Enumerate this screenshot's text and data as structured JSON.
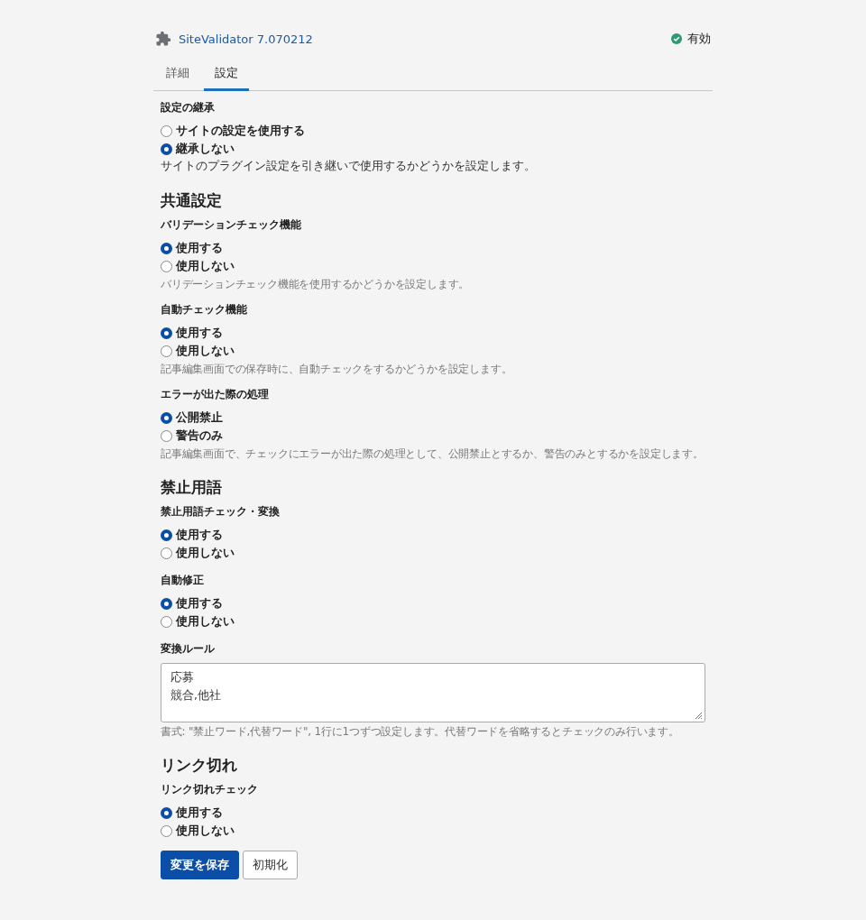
{
  "header": {
    "plugin_name": "SiteValidator 7.070212",
    "status": "有効",
    "enabled": true
  },
  "tabs": [
    {
      "label": "詳細",
      "selected": false
    },
    {
      "label": "設定",
      "selected": true
    }
  ],
  "inheritance": {
    "label": "設定の継承",
    "options": [
      {
        "label": "サイトの設定を使用する",
        "selected": false
      },
      {
        "label": "継承しない",
        "selected": true
      }
    ],
    "description": "サイトのプラグイン設定を引き継いで使用するかどうかを設定します。"
  },
  "sections": [
    {
      "heading": "共通設定",
      "fields": [
        {
          "kind": "radio",
          "label": "バリデーションチェック機能",
          "options": [
            {
              "label": "使用する",
              "selected": true
            },
            {
              "label": "使用しない",
              "selected": false
            }
          ],
          "help": "バリデーションチェック機能を使用するかどうかを設定します。"
        },
        {
          "kind": "radio",
          "label": "自動チェック機能",
          "options": [
            {
              "label": "使用する",
              "selected": true
            },
            {
              "label": "使用しない",
              "selected": false
            }
          ],
          "help": "記事編集画面での保存時に、自動チェックをするかどうかを設定します。"
        },
        {
          "kind": "radio",
          "label": "エラーが出た際の処理",
          "options": [
            {
              "label": "公開禁止",
              "selected": true
            },
            {
              "label": "警告のみ",
              "selected": false
            }
          ],
          "help": "記事編集画面で、チェックにエラーが出た際の処理として、公開禁止とするか、警告のみとするかを設定します。"
        }
      ]
    },
    {
      "heading": "禁止用語",
      "fields": [
        {
          "kind": "radio",
          "label": "禁止用語チェック・変換",
          "options": [
            {
              "label": "使用する",
              "selected": true
            },
            {
              "label": "使用しない",
              "selected": false
            }
          ]
        },
        {
          "kind": "radio",
          "label": "自動修正",
          "options": [
            {
              "label": "使用する",
              "selected": true
            },
            {
              "label": "使用しない",
              "selected": false
            }
          ]
        },
        {
          "kind": "textarea",
          "label": "変換ルール",
          "lines": [
            "応募",
            "競合,他社"
          ],
          "help": "書式: \"禁止ワード,代替ワード\", 1行に1つずつ設定します。代替ワードを省略するとチェックのみ行います。"
        }
      ]
    },
    {
      "heading": "リンク切れ",
      "fields": [
        {
          "kind": "radio",
          "label": "リンク切れチェック",
          "options": [
            {
              "label": "使用する",
              "selected": true
            },
            {
              "label": "使用しない",
              "selected": false
            }
          ]
        }
      ]
    }
  ],
  "buttons": [
    {
      "label": "変更を保存",
      "kind": "primary"
    },
    {
      "label": "初期化",
      "kind": "secondary"
    }
  ]
}
